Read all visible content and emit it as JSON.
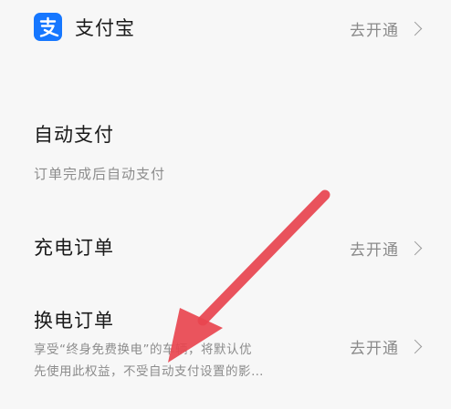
{
  "alipay": {
    "name": "支付宝",
    "action": "去开通"
  },
  "auto_pay": {
    "title": "自动支付",
    "subtitle": "订单完成后自动支付"
  },
  "charging_order": {
    "title": "充电订单",
    "action": "去开通"
  },
  "swap_order": {
    "title": "换电订单",
    "action": "去开通",
    "desc_line1": "享受“终身免费换电”的车辆，将默认优",
    "desc_line2": "先使用此权益，不受自动支付设置的影…"
  },
  "colors": {
    "alipay_blue": "#1677ff",
    "annotation_arrow": "#e8454f"
  }
}
